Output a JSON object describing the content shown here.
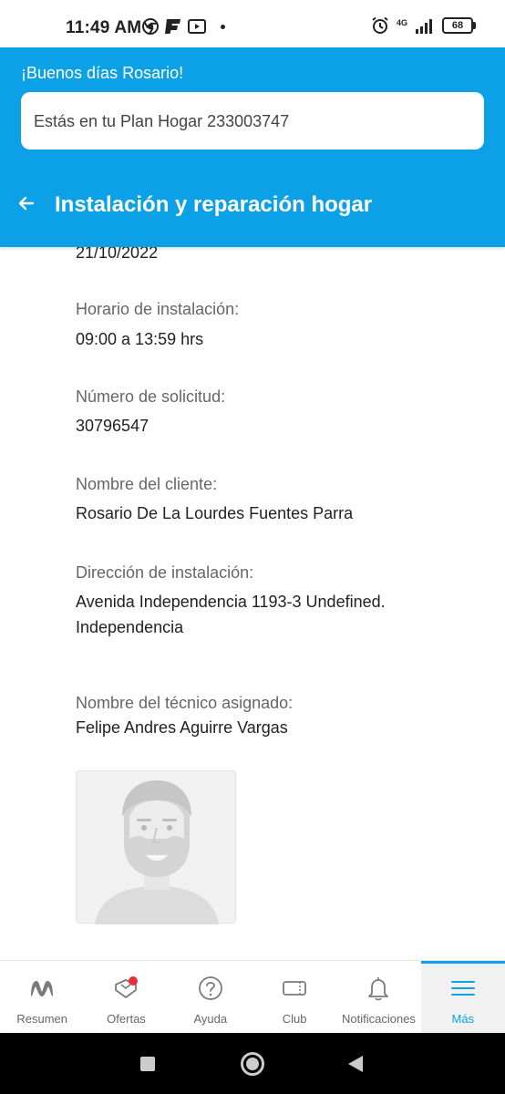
{
  "status_bar": {
    "time": "11:49 AM",
    "network": "4G",
    "battery": "68"
  },
  "header": {
    "greeting": "¡Buenos días Rosario!",
    "plan_text": "Estás en tu Plan Hogar 233003747"
  },
  "title_bar": {
    "title": "Instalación y reparación hogar"
  },
  "details": {
    "date_value": "21/10/2022",
    "schedule_label": "Horario de instalación:",
    "schedule_value": "09:00 a 13:59 hrs",
    "request_label": "Número de solicitud:",
    "request_value": "30796547",
    "client_label": "Nombre del cliente:",
    "client_value": "Rosario De La Lourdes Fuentes Parra",
    "address_label": "Dirección de instalación:",
    "address_line1": "Avenida Independencia 1193-3 Undefined.",
    "address_line2": "Independencia",
    "technician_label": "Nombre del técnico asignado:",
    "technician_value": "Felipe Andres Aguirre Vargas"
  },
  "bottom_nav": {
    "items": [
      {
        "label": "Resumen",
        "icon": "movistar-logo-icon"
      },
      {
        "label": "Ofertas",
        "icon": "gift-icon"
      },
      {
        "label": "Ayuda",
        "icon": "help-icon"
      },
      {
        "label": "Club",
        "icon": "ticket-icon"
      },
      {
        "label": "Notificaciones",
        "icon": "bell-icon"
      },
      {
        "label": "Más",
        "icon": "menu-icon"
      }
    ],
    "active_index": 5
  },
  "colors": {
    "brand": "#0ca1e6",
    "offer_badge": "#e5303a",
    "nav_icon": "#7a7a7a"
  }
}
